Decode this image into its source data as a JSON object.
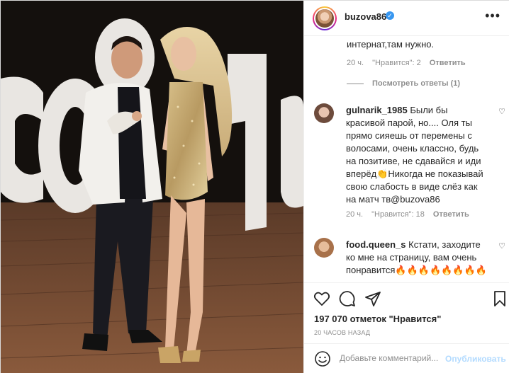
{
  "post": {
    "username": "buzova86",
    "verified_glyph": "✓",
    "more_glyph": "•••"
  },
  "photo": {
    "sign_text": "COSMO",
    "description_icon": "photo-of-two-people"
  },
  "comments": {
    "first_tail": {
      "text": "интернат,там нужно.",
      "time": "20 ч.",
      "likes": "\"Нравится\": 2",
      "reply": "Ответить"
    },
    "view_replies": "Посмотреть ответы (1)",
    "items": [
      {
        "username": "gulnarik_1985",
        "text": "Были бы красивой парой, но.... Оля ты прямо сияешь от перемены с волосами, очень классно, будь на позитиве, не сдавайся и иди вперёд👏Никогда не показывай свою слабость в виде слёз как на матч тв@buzova86",
        "time": "20 ч.",
        "likes": "\"Нравится\": 18",
        "reply": "Ответить"
      },
      {
        "username": "food.queen_s",
        "text": "Кстати, заходите ко мне на страницу, вам очень понравится🔥🔥🔥🔥🔥🔥🔥🔥"
      }
    ],
    "heart_glyph": "♡"
  },
  "footer": {
    "likes_count": "197 070 отметок \"Нравится\"",
    "timestamp": "20 ЧАСОВ НАЗАД",
    "comment_placeholder": "Добавьте комментарий...",
    "publish_label": "Опубликовать"
  },
  "colors": {
    "accent": "#3897f0",
    "publish_disabled": "#b3dbff",
    "meta_grey": "#8e8e8e"
  }
}
